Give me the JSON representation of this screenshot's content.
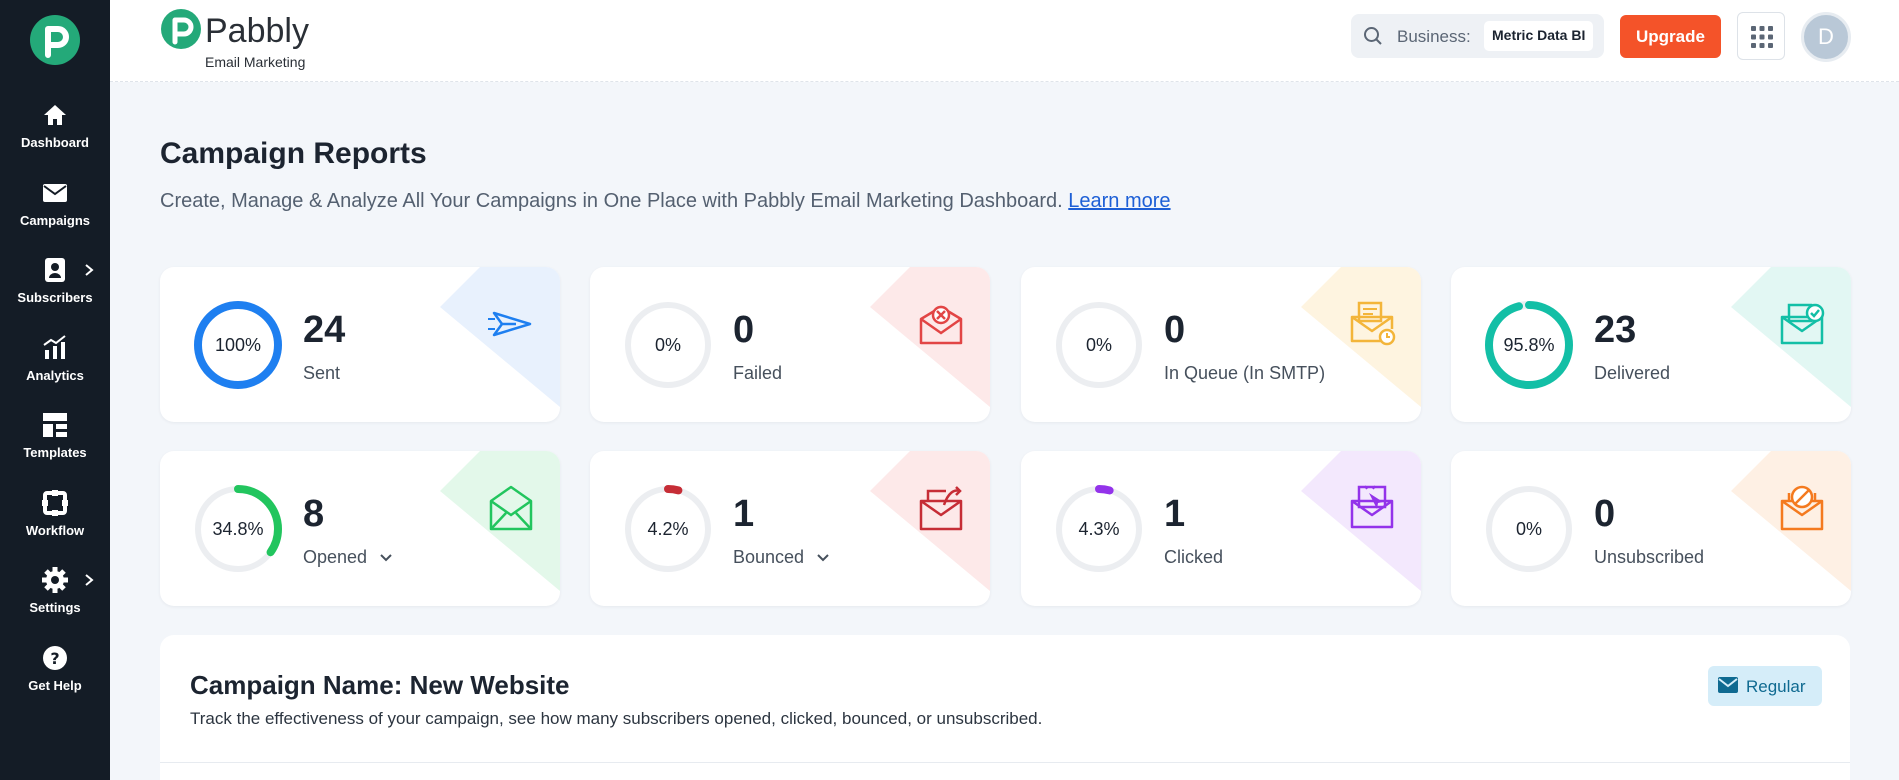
{
  "sidebar": {
    "items": [
      {
        "label": "Dashboard",
        "icon": "home-icon"
      },
      {
        "label": "Campaigns",
        "icon": "envelope-icon"
      },
      {
        "label": "Subscribers",
        "icon": "contact-card-icon",
        "has_submenu": true
      },
      {
        "label": "Analytics",
        "icon": "analytics-icon"
      },
      {
        "label": "Templates",
        "icon": "template-icon"
      },
      {
        "label": "Workflow",
        "icon": "workflow-icon"
      },
      {
        "label": "Settings",
        "icon": "gear-icon",
        "has_submenu": true
      },
      {
        "label": "Get Help",
        "icon": "help-icon"
      }
    ]
  },
  "header": {
    "brand_name": "Pabbly",
    "brand_sub": "Email Marketing",
    "business_label": "Business:",
    "business_value": "Metric Data BI",
    "upgrade_label": "Upgrade",
    "avatar_initial": "D"
  },
  "page": {
    "title": "Campaign Reports",
    "description": "Create, Manage & Analyze All Your Campaigns in One Place with Pabbly Email Marketing Dashboard.",
    "learn_more": "Learn more"
  },
  "stats": [
    {
      "percent": "100%",
      "fraction": 1.0,
      "value": "24",
      "label": "Sent",
      "color": "#1e7ff0",
      "tint": "#e8f1fd",
      "icon": "send-icon"
    },
    {
      "percent": "0%",
      "fraction": 0,
      "value": "0",
      "label": "Failed",
      "color": "#e24545",
      "tint": "#fde9e9",
      "icon": "failed-envelope-icon"
    },
    {
      "percent": "0%",
      "fraction": 0,
      "value": "0",
      "label": "In Queue (In SMTP)",
      "color": "#f3b53a",
      "tint": "#fef4e0",
      "icon": "queued-envelope-icon"
    },
    {
      "percent": "95.8%",
      "fraction": 0.958,
      "value": "23",
      "label": "Delivered",
      "color": "#13bfa6",
      "tint": "#e2f7f3",
      "icon": "delivered-envelope-icon"
    },
    {
      "percent": "34.8%",
      "fraction": 0.348,
      "value": "8",
      "label": "Opened",
      "color": "#22c55e",
      "tint": "#e3f8ea",
      "icon": "opened-envelope-icon",
      "dropdown": true
    },
    {
      "percent": "4.2%",
      "fraction": 0.042,
      "value": "1",
      "label": "Bounced",
      "color": "#c62d36",
      "tint": "#fde9e9",
      "icon": "bounced-envelope-icon",
      "dropdown": true
    },
    {
      "percent": "4.3%",
      "fraction": 0.043,
      "value": "1",
      "label": "Clicked",
      "color": "#9333ea",
      "tint": "#f3e8fd",
      "icon": "clicked-envelope-icon"
    },
    {
      "percent": "0%",
      "fraction": 0,
      "value": "0",
      "label": "Unsubscribed",
      "color": "#f47a1f",
      "tint": "#fef0e4",
      "icon": "unsubscribed-envelope-icon"
    }
  ],
  "campaign": {
    "title": "Campaign Name: New Website",
    "description": "Track the effectiveness of your campaign, see how many subscribers opened, clicked, bounced, or unsubscribed.",
    "type_label": "Regular"
  }
}
